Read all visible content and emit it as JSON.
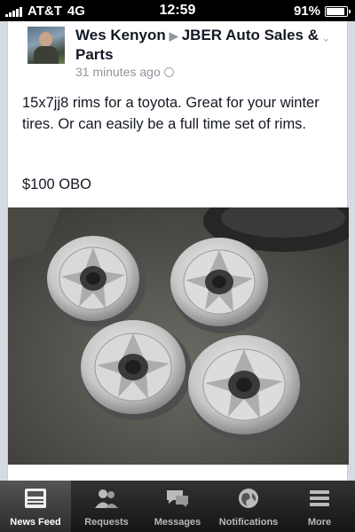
{
  "status_bar": {
    "carrier": "AT&T",
    "network": "4G",
    "time": "12:59",
    "battery": "91%",
    "battery_level": 0.91
  },
  "post": {
    "author": "Wes Kenyon",
    "group": "JBER Auto Sales & Parts",
    "timestamp": "31 minutes ago",
    "text": "15x7jj8 rims for a toyota. Great for your winter tires. Or can easily be a full time set of rims.",
    "price": "$100 OBO"
  },
  "tab_bar": {
    "tabs": [
      {
        "label": "News Feed",
        "icon": "news-feed-icon",
        "active": true
      },
      {
        "label": "Requests",
        "icon": "requests-icon",
        "active": false
      },
      {
        "label": "Messages",
        "icon": "messages-icon",
        "active": false
      },
      {
        "label": "Notifications",
        "icon": "notifications-icon",
        "active": false
      },
      {
        "label": "More",
        "icon": "more-icon",
        "active": false
      }
    ]
  }
}
